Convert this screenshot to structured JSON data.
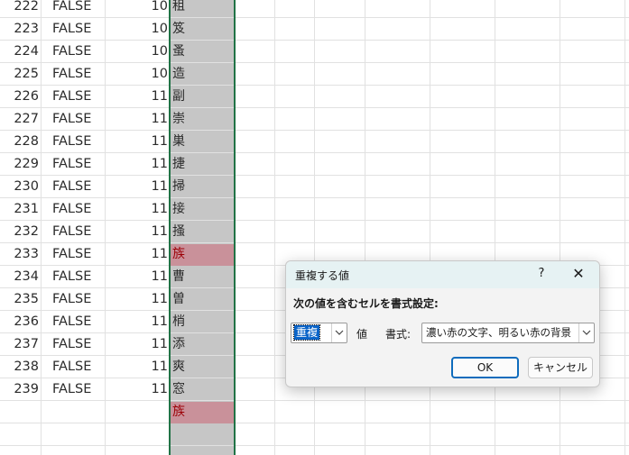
{
  "sheet": {
    "rows": [
      {
        "n": "222",
        "b": "FALSE",
        "c": "10",
        "d": "租"
      },
      {
        "n": "223",
        "b": "FALSE",
        "c": "10",
        "d": "笈"
      },
      {
        "n": "224",
        "b": "FALSE",
        "c": "10",
        "d": "蚤"
      },
      {
        "n": "225",
        "b": "FALSE",
        "c": "10",
        "d": "造"
      },
      {
        "n": "226",
        "b": "FALSE",
        "c": "11",
        "d": "副"
      },
      {
        "n": "227",
        "b": "FALSE",
        "c": "11",
        "d": "崇"
      },
      {
        "n": "228",
        "b": "FALSE",
        "c": "11",
        "d": "巣"
      },
      {
        "n": "229",
        "b": "FALSE",
        "c": "11",
        "d": "捷"
      },
      {
        "n": "230",
        "b": "FALSE",
        "c": "11",
        "d": "掃"
      },
      {
        "n": "231",
        "b": "FALSE",
        "c": "11",
        "d": "接"
      },
      {
        "n": "232",
        "b": "FALSE",
        "c": "11",
        "d": "掻"
      },
      {
        "n": "233",
        "b": "FALSE",
        "c": "11",
        "d": "族"
      },
      {
        "n": "234",
        "b": "FALSE",
        "c": "11",
        "d": "曹"
      },
      {
        "n": "235",
        "b": "FALSE",
        "c": "11",
        "d": "曽"
      },
      {
        "n": "236",
        "b": "FALSE",
        "c": "11",
        "d": "梢"
      },
      {
        "n": "237",
        "b": "FALSE",
        "c": "11",
        "d": "添"
      },
      {
        "n": "238",
        "b": "FALSE",
        "c": "11",
        "d": "爽"
      },
      {
        "n": "239",
        "b": "FALSE",
        "c": "11",
        "d": "窓"
      },
      {
        "n": "",
        "b": "",
        "c": "",
        "d": "族"
      }
    ],
    "highlight_color": "#c9919a",
    "highlight_text_color": "#9c0006",
    "selection_border_color": "#217346"
  },
  "dialog": {
    "title": "重複する値",
    "help": "?",
    "close": "✕",
    "instruction": "次の値を含むセルを書式設定:",
    "type_value": "重複",
    "values_label": "値",
    "format_label": "書式:",
    "format_value": "濃い赤の文字、明るい赤の背景",
    "ok": "OK",
    "cancel": "キャンセル"
  }
}
